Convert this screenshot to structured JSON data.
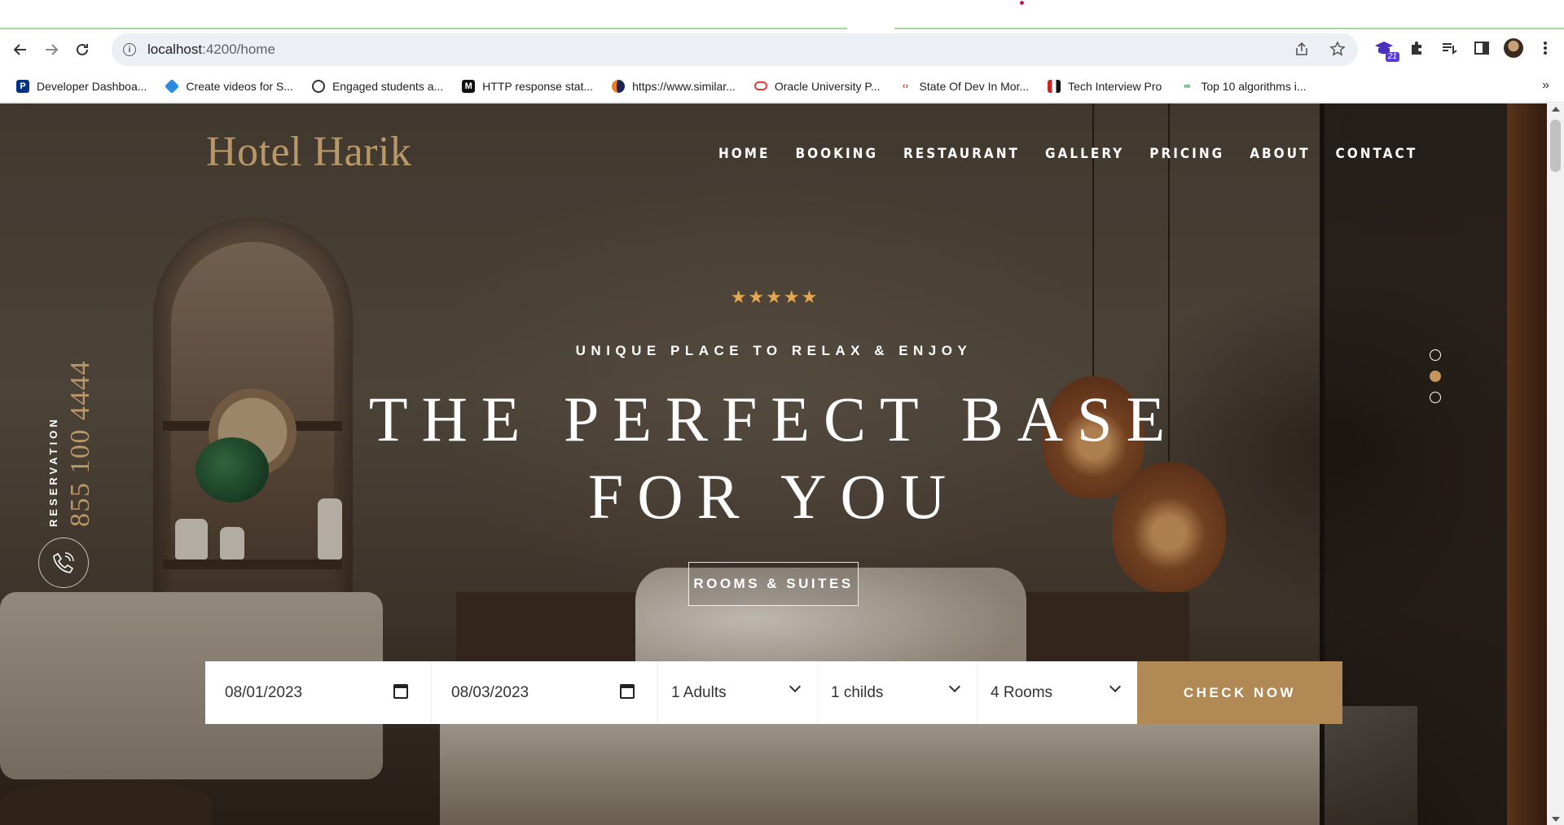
{
  "browser": {
    "url_host": "localhost",
    "url_path": ":4200/home",
    "extension_badge": "21",
    "bookmarks": [
      {
        "label": "Developer Dashboa...",
        "icon": "paypal-icon",
        "color": "#003087"
      },
      {
        "label": "Create videos for S...",
        "icon": "diamond-icon",
        "color": "#2a8be0"
      },
      {
        "label": "Engaged students a...",
        "icon": "globe-icon",
        "color": "#333333"
      },
      {
        "label": "HTTP response stat...",
        "icon": "mdn-icon",
        "color": "#111111"
      },
      {
        "label": "https://www.similar...",
        "icon": "similarweb-icon",
        "color": "#f17a22"
      },
      {
        "label": "Oracle University P...",
        "icon": "oracle-icon",
        "color": "#e53935"
      },
      {
        "label": "State Of Dev In Mor...",
        "icon": "code-icon",
        "color": "#e53935"
      },
      {
        "label": "Tech Interview Pro",
        "icon": "tip-icon",
        "color": "#c62828"
      },
      {
        "label": "Top 10 algorithms i...",
        "icon": "gfg-icon",
        "color": "#2f8d46"
      }
    ]
  },
  "site": {
    "logo": "Hotel Harik",
    "nav": [
      "HOME",
      "BOOKING",
      "RESTAURANT",
      "GALLERY",
      "PRICING",
      "ABOUT",
      "CONTACT"
    ],
    "accent": "#b08955"
  },
  "hero": {
    "stars": "★★★★★",
    "tagline": "UNIQUE PLACE TO RELAX & ENJOY",
    "headline_line1": "THE PERFECT BASE",
    "headline_line2": "FOR YOU",
    "cta": "ROOMS & SUITES",
    "slider_active_index": 1
  },
  "reservation": {
    "label": "RESERVATION",
    "phone": "855 100 4444"
  },
  "booking": {
    "check_in": "08/01/2023",
    "check_out": "08/03/2023",
    "adults": "1 Adults",
    "childs": "1 childs",
    "rooms": "4 Rooms",
    "submit": "CHECK NOW"
  }
}
